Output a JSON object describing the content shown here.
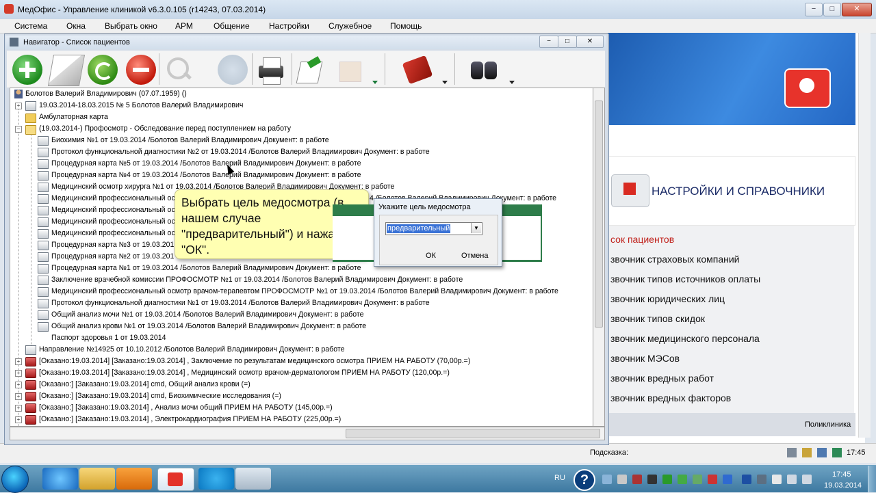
{
  "app": {
    "title": "МедОфис - Управление клиникой v6.3.0.105 (r14243, 07.03.2014)"
  },
  "window_controls": {
    "minimize": "−",
    "maximize": "□",
    "close": "✕"
  },
  "menu": [
    "Система",
    "Окна",
    "Выбрать окно",
    "АРМ",
    "Общение",
    "Настройки",
    "Служебное",
    "Помощь"
  ],
  "navigator": {
    "title": "Навигатор - Список пациентов",
    "toolbar_icons": [
      "add-icon",
      "edit-icon",
      "refresh-icon",
      "delete-icon",
      "search-icon",
      "sort-icon",
      "print-icon",
      "export-icon",
      "import-icon",
      "spellcheck-icon",
      "binoculars-icon"
    ],
    "tree": [
      {
        "text": "Болотов Валерий Владимирович (07.07.1959) ()",
        "icon": "person-icon"
      },
      {
        "text": "19.03.2014-18.03.2015 № 5 Болотов Валерий Владимирович",
        "icon": "document-icon"
      },
      {
        "text": "Амбулаторная карта",
        "icon": "folder-icon"
      },
      {
        "text": "(19.03.2014-) Профосмотр - Обследование перед поступлением на работу",
        "icon": "folder-open-icon"
      },
      {
        "text": "Биохимия №1 от 19.03.2014 /Болотов Валерий Владимирович Документ: в работе",
        "icon": "document-icon"
      },
      {
        "text": "Протокол функциональной диагностики №2 от 19.03.2014 /Болотов Валерий Владимирович Документ: в работе",
        "icon": "document-icon"
      },
      {
        "text": "Процедурная карта №5 от 19.03.2014 /Болотов Валерий Владимирович Документ: в работе",
        "icon": "document-icon"
      },
      {
        "text": "Процедурная карта №4 от 19.03.2014 /Болотов Валерий Владимирович Документ: в работе",
        "icon": "document-icon"
      },
      {
        "text": "Медицинский осмотр хирурга №1 от 19.03.2014 /Болотов Валерий Владимирович Документ: в работе",
        "icon": "document-icon"
      },
      {
        "text": "Медицинский профессиональный осм",
        "tail": "4 /Болотов Валерий Владимирович Документ: в работе",
        "icon": "document-icon"
      },
      {
        "text": "Медицинский профессиональный осм",
        "tail": "",
        "icon": "document-icon"
      },
      {
        "text": "Медицинский профессиональный осм",
        "tail": "",
        "icon": "document-icon"
      },
      {
        "text": "Медицинский профессиональный осм",
        "tail": "",
        "icon": "document-icon"
      },
      {
        "text": "Процедурная карта №3 от 19.03.201",
        "icon": "document-icon"
      },
      {
        "text": "Процедурная карта №2 от 19.03.201",
        "icon": "document-icon"
      },
      {
        "text": "Процедурная карта №1 от 19.03.2014 /Болотов Валерий Владимирович Документ: в работе",
        "icon": "document-icon"
      },
      {
        "text": "Заключение врачебной комиссии ПРОФОСМОТР №1 от 19.03.2014 /Болотов Валерий Владимирович Документ: в работе",
        "icon": "document-icon"
      },
      {
        "text": "Медицинский профессиональный осмотр врачом-терапевтом ПРОФОСМОТР №1 от 19.03.2014 /Болотов Валерий Владимирович Документ: в работе",
        "icon": "document-icon"
      },
      {
        "text": "Протокол функциональной диагностики №1 от 19.03.2014 /Болотов Валерий Владимирович Документ: в работе",
        "icon": "document-icon"
      },
      {
        "text": "Общий анализ мочи №1 от 19.03.2014 /Болотов Валерий Владимирович Документ: в работе",
        "icon": "document-icon"
      },
      {
        "text": "Общий анализ крови №1 от 19.03.2014 /Болотов Валерий Владимирович Документ: в работе",
        "icon": "document-icon"
      },
      {
        "text": "Паспорт здоровья 1 от 19.03.2014",
        "icon": "none"
      },
      {
        "text": "Направление №14925 от 10.10.2012 /Болотов Валерий Владимирович Документ: в работе",
        "icon": "document-icon"
      },
      {
        "text": "[Оказано:19.03.2014] [Заказано:19.03.2014] , Заключение по результатам медицинского осмотра ПРИЕМ НА РАБОТУ (70,00р.=)",
        "icon": "service-icon"
      },
      {
        "text": "[Оказано:19.03.2014] [Заказано:19.03.2014] , Медицинский осмотр врачом-дерматологом ПРИЕМ НА РАБОТУ (120,00р.=)",
        "icon": "service-icon"
      },
      {
        "text": "[Оказано:] [Заказано:19.03.2014] cmd, Общий анализ крови (=)",
        "icon": "service-icon"
      },
      {
        "text": "[Оказано:] [Заказано:19.03.2014] cmd, Биохимические исследования (=)",
        "icon": "service-icon"
      },
      {
        "text": "[Оказано:] [Заказано:19.03.2014] , Анализ мочи общий ПРИЕМ НА РАБОТУ (145,00р.=)",
        "icon": "service-icon"
      },
      {
        "text": "[Оказано:] [Заказано:19.03.2014] , Электрокардиография ПРИЕМ НА РАБОТУ (225,00р.=)",
        "icon": "service-icon"
      }
    ]
  },
  "tooltip": {
    "text": "Выбрать цель медосмотра  (в нашем случае \"предварительный\") и нажать \"ОК\"."
  },
  "dialog": {
    "title": "Укажите цель медосмотра",
    "selected": "предварительный",
    "ok": "ОК",
    "cancel": "Отмена"
  },
  "right_panel": {
    "section_title": "НАСТРОЙКИ И СПРАВОЧНИКИ",
    "items": [
      "сок пациентов",
      "звочник страховых компаний",
      "звочник типов источников оплаты",
      "звочник юридических лиц",
      "звочник типов скидок",
      "звочник медицинского персонала",
      "звочник МЭСов",
      "звочник вредных работ",
      "звочник вредных факторов"
    ],
    "footer": "Поликлиника"
  },
  "statusbar": {
    "hint_label": "Подсказка:",
    "time": "17:45"
  },
  "taskbar": {
    "lang": "RU",
    "time": "17:45",
    "date": "19.03.2014"
  },
  "colors": {
    "accent_blue": "#2467c4",
    "tooltip_bg": "#ffffb2",
    "selection": "#3a72d6",
    "dialog_green": "#2e7d4a"
  }
}
